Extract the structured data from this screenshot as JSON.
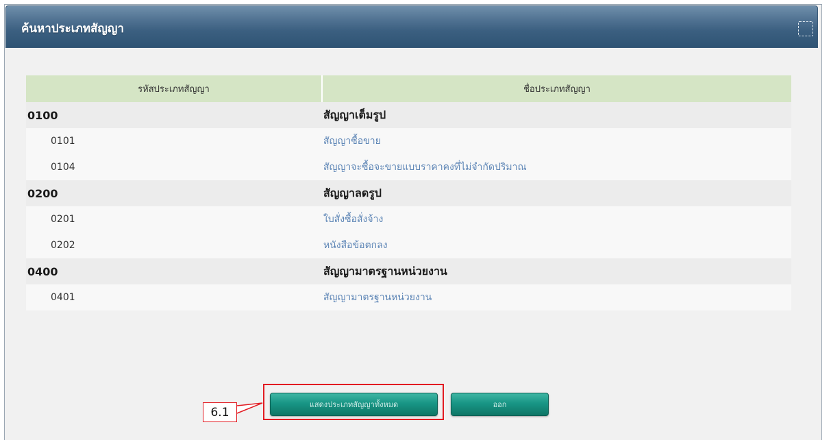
{
  "dialog": {
    "title": "ค้นหาประเภทสัญญา"
  },
  "table": {
    "headers": [
      "รหัสประเภทสัญญา",
      "ชื่อประเภทสัญญา"
    ],
    "rows": [
      {
        "type": "group",
        "code": "0100",
        "name": "สัญญาเต็มรูป"
      },
      {
        "type": "item",
        "code": "0101",
        "name": "สัญญาซื้อขาย"
      },
      {
        "type": "item",
        "code": "0104",
        "name": "สัญญาจะซื้อจะขายแบบราคาคงที่ไม่จำกัดปริมาณ"
      },
      {
        "type": "group",
        "code": "0200",
        "name": "สัญญาลดรูป"
      },
      {
        "type": "item",
        "code": "0201",
        "name": "ใบสั่งซื้อสั่งจ้าง"
      },
      {
        "type": "item",
        "code": "0202",
        "name": "หนังสือข้อตกลง"
      },
      {
        "type": "group",
        "code": "0400",
        "name": "สัญญามาตรฐานหน่วยงาน"
      },
      {
        "type": "item",
        "code": "0401",
        "name": "สัญญามาตรฐานหน่วยงาน"
      }
    ]
  },
  "buttons": {
    "show_all": "แสดงประเภทสัญญาทั้งหมด",
    "exit": "ออก"
  },
  "annotation": {
    "label": "6.1"
  },
  "colors": {
    "titlebar": "#3b5f80",
    "header_bg": "#d5e5c5",
    "group_bg": "#ececec",
    "link": "#5e86b6",
    "button": "#189585",
    "annotation": "#e21b22"
  }
}
